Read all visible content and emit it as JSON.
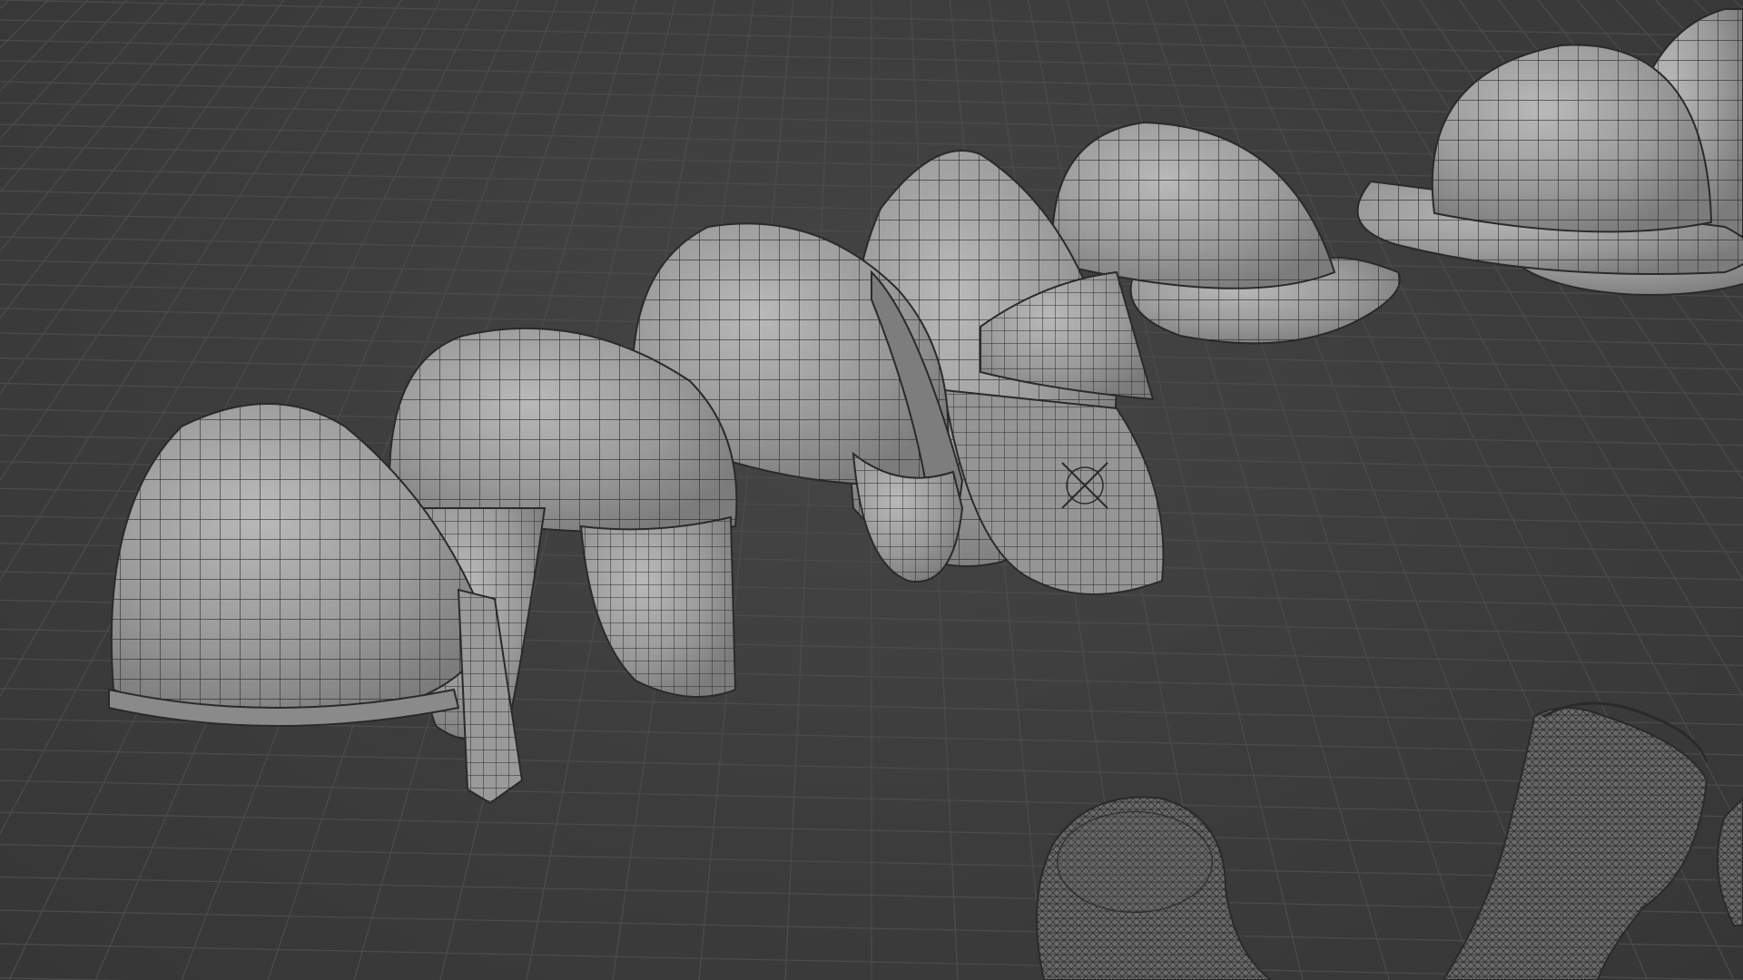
{
  "viewport": {
    "type": "3d-viewport",
    "shading": "solid-wireframe",
    "colors": {
      "background": "#3c3c3c",
      "grid": "#4a4a4a",
      "mesh_fill": "#9c9c9c",
      "mesh_wire": "#2a2a2a",
      "sculpt_fill": "#6e6e6e"
    }
  },
  "objects": [
    {
      "name": "helmet-nasal-front",
      "kind": "quad-mesh"
    },
    {
      "name": "helmet-cheek-guard",
      "kind": "quad-mesh"
    },
    {
      "name": "helmet-nasal-crest",
      "kind": "quad-mesh"
    },
    {
      "name": "helmet-with-aventail",
      "kind": "quad-mesh"
    },
    {
      "name": "kettle-hat",
      "kind": "quad-mesh"
    },
    {
      "name": "kettle-hat-back",
      "kind": "quad-mesh"
    },
    {
      "name": "kettle-hat-far",
      "kind": "quad-mesh"
    },
    {
      "name": "sculpt-boot-left",
      "kind": "triangulated-mesh"
    },
    {
      "name": "sculpt-boot-right",
      "kind": "triangulated-mesh"
    },
    {
      "name": "sculpt-partial-edge",
      "kind": "triangulated-mesh"
    }
  ]
}
